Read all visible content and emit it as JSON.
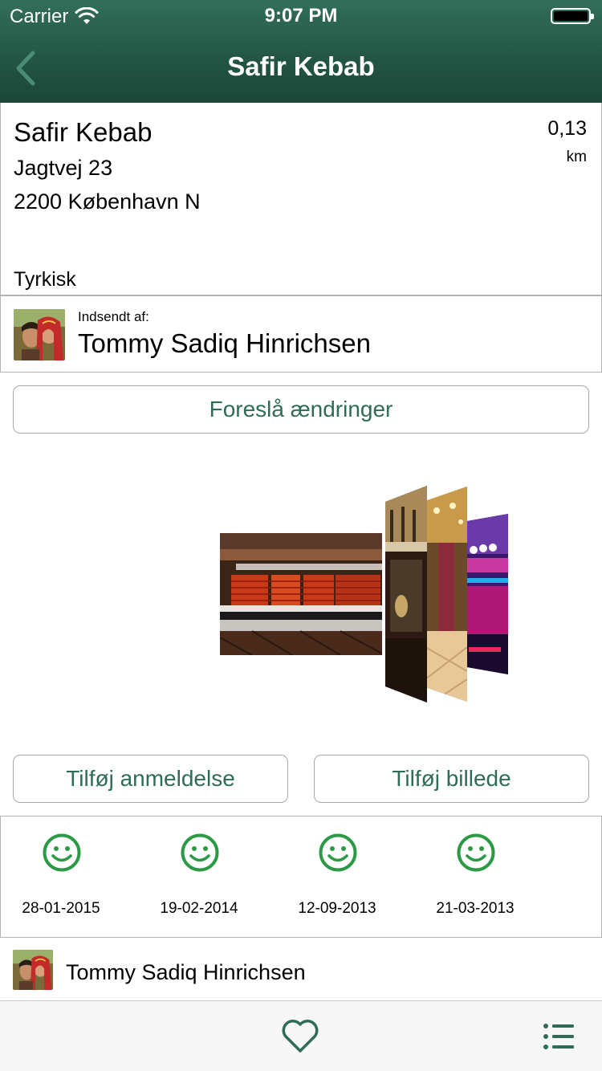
{
  "status_bar": {
    "carrier": "Carrier",
    "time": "9:07 PM"
  },
  "nav": {
    "title": "Safir Kebab"
  },
  "place": {
    "name": "Safir Kebab",
    "street": "Jagtvej  23",
    "city": "2200 København N",
    "cuisine": "Tyrkisk",
    "distance": "0,13",
    "distance_unit": "km"
  },
  "submitter": {
    "label": "Indsendt af:",
    "name": "Tommy Sadiq Hinrichsen"
  },
  "actions": {
    "suggest_changes": "Foreslå ændringer",
    "add_review": "Tilføj anmeldelse",
    "add_photo": "Tilføj billede"
  },
  "reviews": [
    {
      "icon": "smiley-icon",
      "date": "28-01-2015"
    },
    {
      "icon": "smiley-icon",
      "date": "19-02-2014"
    },
    {
      "icon": "smiley-icon",
      "date": "12-09-2013"
    },
    {
      "icon": "smiley-icon",
      "date": "21-03-2013"
    }
  ],
  "reviewer": {
    "name": "Tommy Sadiq Hinrichsen"
  },
  "tabbar": {
    "icons": [
      "heart-icon",
      "list-icon"
    ]
  },
  "colors": {
    "header_top": "#326f5a",
    "header_bottom": "#1b4637",
    "accent": "#2f6b59",
    "smiley": "#2c9a45"
  }
}
